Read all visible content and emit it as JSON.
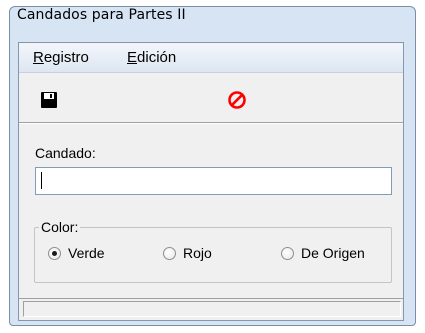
{
  "window": {
    "title": "Candados para Partes II"
  },
  "menu": {
    "items": [
      {
        "label_first": "R",
        "label_rest": "egistro"
      },
      {
        "label_first": "E",
        "label_rest": "dición"
      }
    ]
  },
  "toolbar": {
    "save_icon": "floppy-disk-icon",
    "cancel_icon": "no-entry-icon",
    "cancel_color": "#ff0000"
  },
  "form": {
    "candado_label": "Candado:",
    "candado_value": "",
    "color_group_label": "Color:",
    "options": [
      {
        "label": "Verde",
        "selected": true
      },
      {
        "label": "Rojo",
        "selected": false
      },
      {
        "label": "De Origen",
        "selected": false
      }
    ]
  },
  "status": {
    "text": ""
  }
}
